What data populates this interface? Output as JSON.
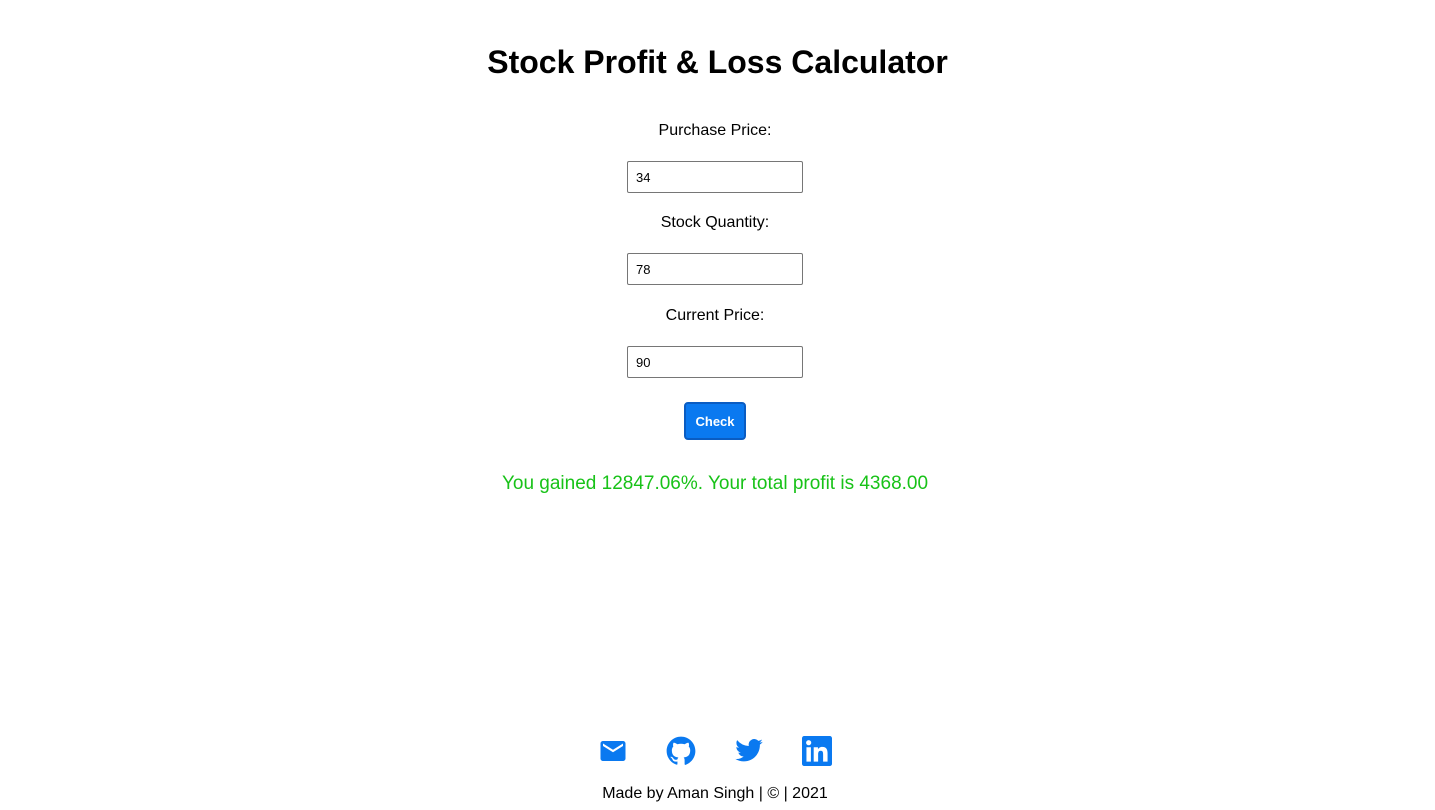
{
  "page": {
    "title": "Stock Profit & Loss Calculator"
  },
  "form": {
    "purchase_price": {
      "label": "Purchase Price:",
      "value": "34"
    },
    "stock_quantity": {
      "label": "Stock Quantity:",
      "value": "78"
    },
    "current_price": {
      "label": "Current Price:",
      "value": "90"
    },
    "check_label": "Check"
  },
  "result": {
    "message": "You gained 12847.06%. Your total profit is 4368.00",
    "color": "#18c218"
  },
  "social": [
    {
      "icon": "mail-icon"
    },
    {
      "icon": "github-icon"
    },
    {
      "icon": "twitter-icon"
    },
    {
      "icon": "linkedin-icon"
    }
  ],
  "footer": {
    "text": "Made by Aman Singh | © | 2021"
  },
  "colors": {
    "accent": "#0a79f0"
  }
}
